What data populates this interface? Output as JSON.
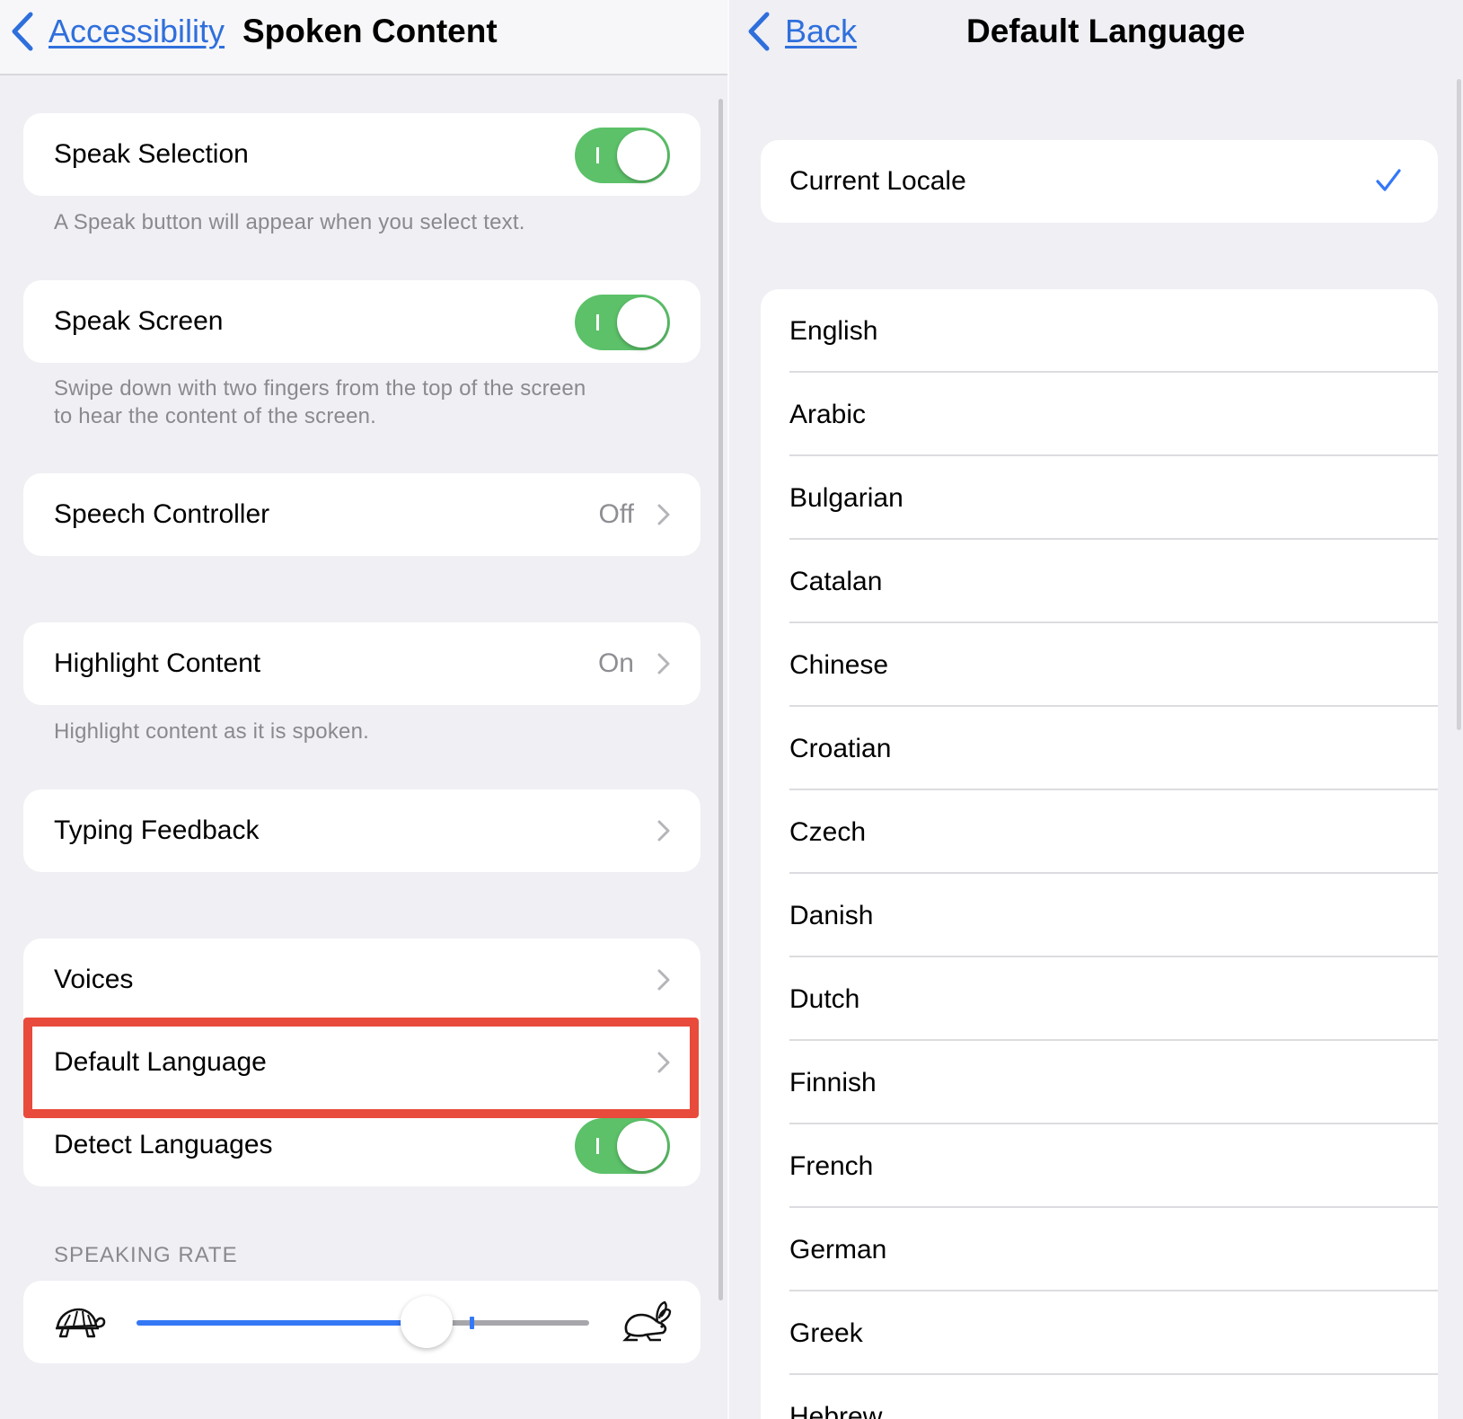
{
  "left": {
    "nav": {
      "back_label": "Accessibility",
      "title": "Spoken Content"
    },
    "speak_selection": {
      "label": "Speak Selection",
      "footer": "A Speak button will appear when you select text."
    },
    "speak_screen": {
      "label": "Speak Screen",
      "footer_line1": "Swipe down with two fingers from the top of the screen",
      "footer_line2": "to hear the content of the screen."
    },
    "speech_controller": {
      "label": "Speech Controller",
      "value": "Off"
    },
    "highlight_content": {
      "label": "Highlight Content",
      "value": "On",
      "footer": "Highlight content as it is spoken."
    },
    "typing_feedback": {
      "label": "Typing Feedback"
    },
    "voices": {
      "label": "Voices"
    },
    "default_language": {
      "label": "Default Language"
    },
    "detect_languages": {
      "label": "Detect Languages"
    },
    "speaking_rate": {
      "section_label": "SPEAKING RATE",
      "value_fraction": 0.64,
      "midpoint_marker_fraction": 0.5
    },
    "toggles": {
      "speak_selection_on": true,
      "speak_screen_on": true,
      "detect_languages_on": true
    }
  },
  "right": {
    "nav": {
      "back_label": "Back",
      "title": "Default Language"
    },
    "current_locale": {
      "label": "Current Locale",
      "selected": true
    },
    "languages": [
      "English",
      "Arabic",
      "Bulgarian",
      "Catalan",
      "Chinese",
      "Croatian",
      "Czech",
      "Danish",
      "Dutch",
      "Finnish",
      "French",
      "German",
      "Greek",
      "Hebrew"
    ]
  },
  "colors": {
    "accent": "#3478f6",
    "toggle_on": "#5cc169",
    "highlight": "#e84a3b",
    "secondary_text": "#8a8a8e"
  },
  "icons": [
    "chevron-left-icon",
    "chevron-right-icon",
    "checkmark-icon",
    "turtle-icon",
    "rabbit-icon"
  ]
}
